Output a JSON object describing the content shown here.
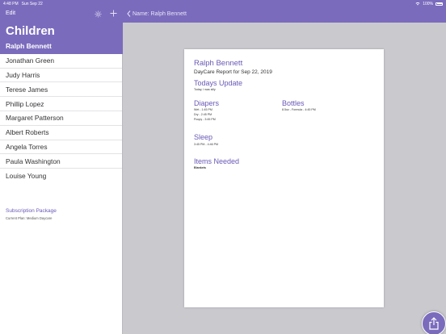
{
  "status": {
    "time": "4:48 PM",
    "date": "Sun Sep 22",
    "battery": "100%"
  },
  "sidebar": {
    "edit_label": "Edit",
    "title": "Children",
    "children": [
      "Ralph Bennett",
      "Jonathan Green",
      "Judy Harris",
      "Terese James",
      "Phillip Lopez",
      "Margaret Patterson",
      "Albert Roberts",
      "Angela Torres",
      "Paula Washington",
      "Louise Young"
    ],
    "selected_index": 0,
    "subscription_label": "Subscription Package",
    "current_plan": "Current Plan: Medium Daycare"
  },
  "detail": {
    "back_label": "Name: Ralph Bennett",
    "report": {
      "name": "Ralph Bennett",
      "subtitle": "DayCare Report for Sep 22, 2019",
      "todays_update_heading": "Todays Update",
      "todays_update_text": "Today, I was silly",
      "diapers_heading": "Diapers",
      "diapers": [
        "Wet - 1:45 PM",
        "Dry - 2:45 PM",
        "Poopy - 3:45 PM"
      ],
      "bottles_heading": "Bottles",
      "bottles": [
        "8.5oz - Formula - 4:45 PM"
      ],
      "sleep_heading": "Sleep",
      "sleep": [
        "3:45 PM - 4:46 PM"
      ],
      "items_heading": "Items Needed",
      "items": [
        "Blankets"
      ]
    }
  },
  "colors": {
    "accent": "#7b6bbd",
    "accent_text": "#6a58b6"
  },
  "icons": {
    "gear": "gear-icon",
    "add": "plus-icon",
    "back": "chevron-left-icon",
    "share": "share-icon",
    "wifi": "wifi-icon",
    "battery": "battery-icon"
  }
}
